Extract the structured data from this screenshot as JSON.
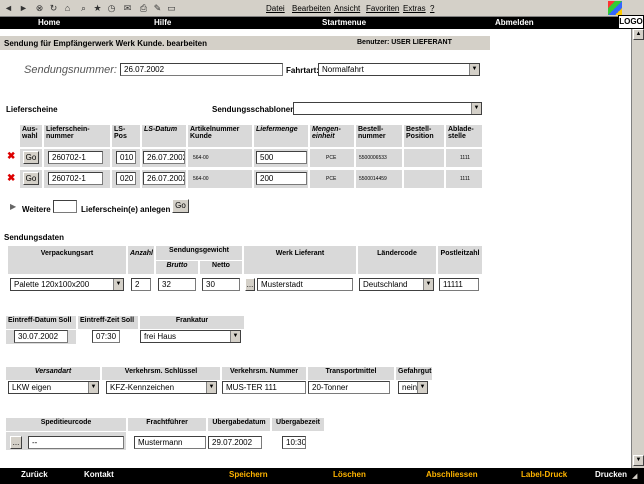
{
  "browser": {
    "menu": [
      "Datei",
      "Bearbeiten",
      "Ansicht",
      "Favoriten",
      "Extras",
      "?"
    ],
    "logo": "LOGO"
  },
  "nav": {
    "home": "Home",
    "help": "Hilfe",
    "start": "Startmenue",
    "logout": "Abmelden"
  },
  "page": {
    "title": "Sendung für Empfängerwerk Werk Kunde. bearbeiten",
    "user_label": "Benutzer: USER LIEFERANT"
  },
  "shipment": {
    "number_label": "Sendungsnummer:",
    "number_value": "26.07.2002",
    "fahrtart_label": "Fahrtart:",
    "fahrtart_value": "Normalfahrt"
  },
  "lieferscheine": {
    "section_label": "Lieferscheine",
    "template_label": "Sendungsschablonen:",
    "template_value": "",
    "headers": {
      "auswahl": "Aus-\nwahl",
      "nummer": "Lieferschein-\nnummer",
      "pos": "LS-\nPos",
      "datum": "LS-Datum",
      "artikel": "Artikelnummer\nKunde",
      "menge": "Liefermenge",
      "einheit": "Mengen-\neinheit",
      "bestellnr": "Bestell-\nnummer",
      "bestellpos": "Bestell-\nPosition",
      "abladestelle": "Ablade-\nstelle"
    },
    "go_label": "Go",
    "rows": [
      {
        "nummer": "260702-1",
        "pos": "010",
        "datum": "26.07.2002",
        "artikel": "564-00",
        "menge": "500",
        "einheit": "PCE",
        "bestellnr": "5500006533",
        "bestellpos": "",
        "abladestelle": "1111"
      },
      {
        "nummer": "260702-1",
        "pos": "020",
        "datum": "26.07.2002",
        "artikel": "564-00",
        "menge": "200",
        "einheit": "PCE",
        "bestellnr": "5500014459",
        "bestellpos": "",
        "abladestelle": "1111"
      }
    ],
    "more_prefix": "Weitere",
    "more_count": "",
    "more_suffix": "Lieferschein(e) anlegen"
  },
  "sendungsdaten": {
    "section_label": "Sendungsdaten",
    "headers": {
      "verpackungsart": "Verpackungsart",
      "anzahl": "Anzahl",
      "gewicht": "Sendungsgewicht",
      "brutto": "Brutto",
      "netto": "Netto",
      "werk": "Werk Lieferant",
      "laendercode": "Ländercode",
      "plz": "Postleitzahl"
    },
    "verpackungsart": "Palette 120x100x200",
    "anzahl": "2",
    "brutto": "32",
    "netto": "30",
    "werk": "Musterstadt",
    "laendercode": "Deutschland",
    "plz": "11111",
    "lookup_label": "..."
  },
  "termine": {
    "headers": {
      "datum": "Eintreff-Datum Soll",
      "zeit": "Eintreff-Zeit Soll",
      "frankatur": "Frankatur"
    },
    "datum": "30.07.2002",
    "zeit": "07:30",
    "frankatur": "frei Haus"
  },
  "versand": {
    "headers": {
      "versandart": "Versandart",
      "schluessel": "Verkehrsm. Schlüssel",
      "nummer": "Verkehrsm. Nummer",
      "transportmittel": "Transportmittel",
      "gefahrgut": "Gefahrgut"
    },
    "versandart": "LKW eigen",
    "schluessel": "KFZ-Kennzeichen",
    "nummer": "MUS-TER 111",
    "transportmittel": "20-Tonner",
    "gefahrgut": "nein"
  },
  "spediteur": {
    "headers": {
      "code": "Speditieurcode",
      "fuehrer": "Frachtführer",
      "datum": "Ubergabedatum",
      "zeit": "Ubergabezeit"
    },
    "code": "--",
    "fuehrer": "Mustermann",
    "datum": "29.07.2002",
    "zeit": "10:30"
  },
  "bottom": {
    "zurueck": "Zurück",
    "kontakt": "Kontakt",
    "speichern": "Speichern",
    "loeschen": "Löschen",
    "abschliessen": "Abschliessen",
    "labeldruck": "Label-Druck",
    "drucken": "Drucken"
  }
}
